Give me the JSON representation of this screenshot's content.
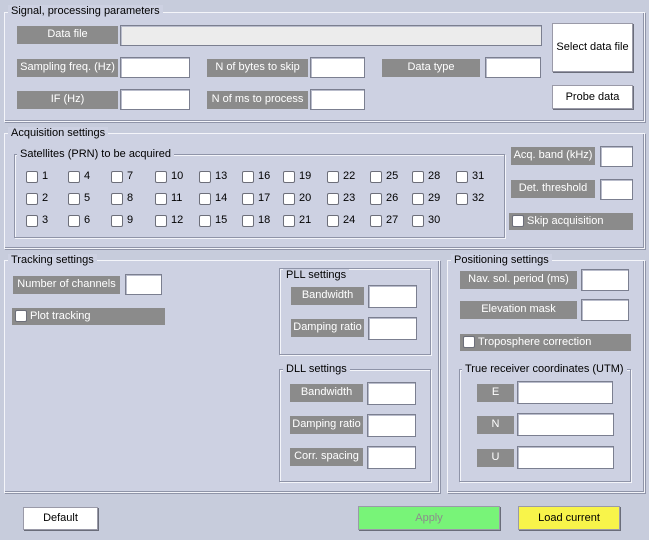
{
  "signal": {
    "title": "Signal, processing parameters",
    "data_file_label": "Data file",
    "sampling_freq_label": "Sampling freq. (Hz)",
    "if_label": "IF (Hz)",
    "bytes_skip_label": "N of bytes to skip",
    "ms_process_label": "N of ms to process",
    "data_type_label": "Data type",
    "select_data_file": "Select data file",
    "probe_data": "Probe data"
  },
  "acquisition": {
    "title": "Acquisition settings",
    "satellites_title": "Satellites (PRN) to be acquired",
    "prn": [
      "1",
      "4",
      "7",
      "10",
      "13",
      "16",
      "19",
      "22",
      "25",
      "28",
      "31",
      "2",
      "5",
      "8",
      "11",
      "14",
      "17",
      "20",
      "23",
      "26",
      "29",
      "32",
      "3",
      "6",
      "9",
      "12",
      "15",
      "18",
      "21",
      "24",
      "27",
      "30"
    ],
    "acq_band_label": "Acq. band (kHz)",
    "det_threshold_label": "Det. threshold",
    "skip_acquisition_label": "Skip acquisition"
  },
  "tracking": {
    "title": "Tracking settings",
    "channels_label": "Number of channels",
    "plot_tracking_label": "Plot tracking",
    "pll_title": "PLL settings",
    "pll_bandwidth_label": "Bandwidth",
    "pll_damping_label": "Damping ratio",
    "dll_title": "DLL settings",
    "dll_bandwidth_label": "Bandwidth",
    "dll_damping_label": "Damping ratio",
    "dll_corr_label": "Corr. spacing"
  },
  "positioning": {
    "title": "Positioning settings",
    "nav_period_label": "Nav. sol. period (ms)",
    "elevation_mask_label": "Elevation mask",
    "troposphere_label": "Troposphere correction",
    "true_coords_title": "True receiver coordinates (UTM)",
    "e_label": "E",
    "n_label": "N",
    "u_label": "U"
  },
  "footer": {
    "default_label": "Default",
    "apply_label": "Apply",
    "load_current_label": "Load current"
  },
  "colors": {
    "background": "#c7ccdc",
    "panel": "#cdd1e2",
    "label_gray": "#8b8b8b",
    "apply_green": "#78f478",
    "load_yellow": "#f8f44a"
  }
}
